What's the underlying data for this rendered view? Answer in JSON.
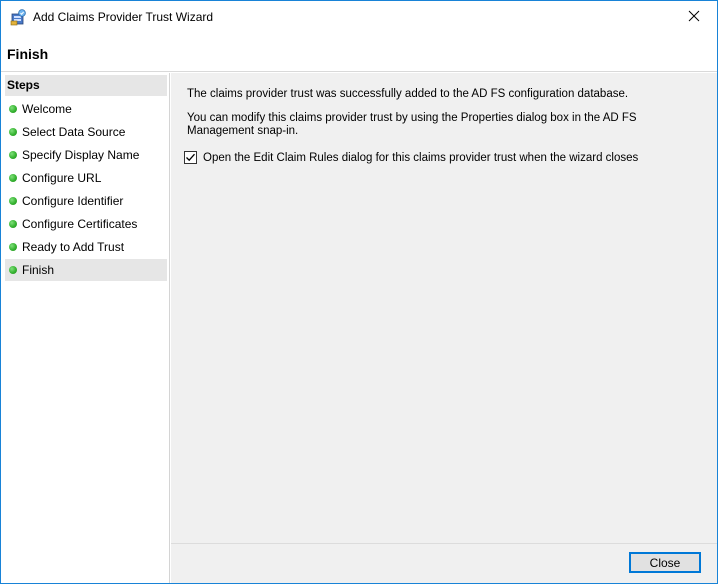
{
  "window": {
    "title": "Add Claims Provider Trust Wizard",
    "app_icon": "adfs-wizard-icon",
    "close_icon": "close-icon"
  },
  "header": {
    "title": "Finish"
  },
  "sidebar": {
    "heading": "Steps",
    "items": [
      {
        "label": "Welcome",
        "status": "complete"
      },
      {
        "label": "Select Data Source",
        "status": "complete"
      },
      {
        "label": "Specify Display Name",
        "status": "complete"
      },
      {
        "label": "Configure URL",
        "status": "complete"
      },
      {
        "label": "Configure Identifier",
        "status": "complete"
      },
      {
        "label": "Configure Certificates",
        "status": "complete"
      },
      {
        "label": "Ready to Add Trust",
        "status": "complete"
      },
      {
        "label": "Finish",
        "status": "current"
      }
    ]
  },
  "content": {
    "message_success": "The claims provider trust was successfully added to the AD FS configuration database.",
    "message_modify": "You can modify this claims provider trust by using the Properties dialog box in the AD FS Management snap-in.",
    "checkbox_label": "Open the Edit Claim Rules dialog for this claims provider trust when the wizard closes",
    "checkbox_checked": true
  },
  "footer": {
    "close_label": "Close"
  },
  "colors": {
    "accent": "#0078d7",
    "step_complete": "#36b331",
    "selected_step_bg": "#e6e6e6",
    "content_bg": "#f0f0f0"
  }
}
